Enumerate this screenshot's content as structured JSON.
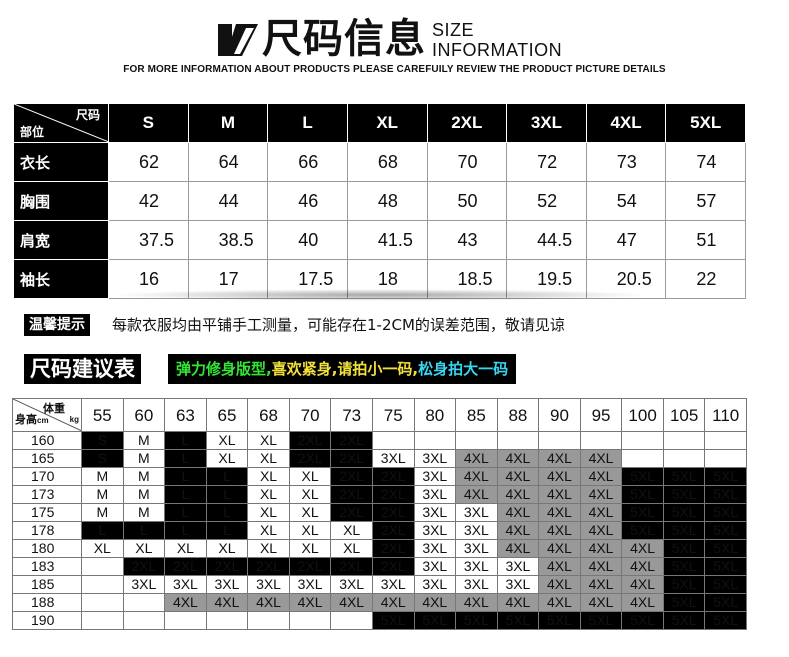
{
  "header": {
    "title_cn": "尺码信息",
    "title_en_line1": "SIZE",
    "title_en_line2": "INFORMATION",
    "subtitle": "FOR MORE INFORMATION ABOUT PRODUCTS PLEASE CAREFUILY REVIEW THE PRODUCT PICTURE DETAILS"
  },
  "size_table": {
    "corner_top": "尺码",
    "corner_bottom": "部位",
    "sizes": [
      "S",
      "M",
      "L",
      "XL",
      "2XL",
      "3XL",
      "4XL",
      "5XL"
    ],
    "rows": [
      {
        "label": "衣长",
        "values": [
          "62",
          "64",
          "66",
          "68",
          "70",
          "72",
          "73",
          "74"
        ]
      },
      {
        "label": "胸围",
        "values": [
          "42",
          "44",
          "46",
          "48",
          "50",
          "52",
          "54",
          "57"
        ]
      },
      {
        "label": "肩宽",
        "values": [
          "37.5",
          "38.5",
          "40",
          "41.5",
          "43",
          "44.5",
          "47",
          "51"
        ]
      },
      {
        "label": "袖长",
        "values": [
          "16",
          "17",
          "17.5",
          "18",
          "18.5",
          "19.5",
          "20.5",
          "22"
        ]
      }
    ]
  },
  "tip": {
    "badge": "温馨提示",
    "text": "每款衣服均由平铺手工测量，可能存在1-2CM的误差范围，敬请见谅"
  },
  "recommend": {
    "title": "尺码建议表",
    "hint_green": "弹力修身版型,",
    "hint_yellow": "喜欢紧身,请拍小一码,",
    "hint_cyan": "松身拍大一码",
    "corner_weight": "体重",
    "corner_kg": "kg",
    "corner_height": "身高",
    "corner_cm": "cm",
    "weights": [
      "55",
      "60",
      "63",
      "65",
      "68",
      "70",
      "73",
      "75",
      "80",
      "85",
      "88",
      "90",
      "95",
      "100",
      "105",
      "110"
    ],
    "rows": [
      {
        "height": "160",
        "cells": [
          "S",
          "M",
          "L",
          "XL",
          "XL",
          "2XL",
          "2XL",
          "",
          "",
          "",
          "",
          "",
          "",
          "",
          "",
          ""
        ]
      },
      {
        "height": "165",
        "cells": [
          "S",
          "M",
          "L",
          "XL",
          "XL",
          "2XL",
          "2XL",
          "3XL",
          "3XL",
          "4XL",
          "4XL",
          "4XL",
          "4XL",
          "",
          "",
          ""
        ]
      },
      {
        "height": "170",
        "cells": [
          "M",
          "M",
          "L",
          "L",
          "XL",
          "XL",
          "2XL",
          "2XL",
          "3XL",
          "4XL",
          "4XL",
          "4XL",
          "4XL",
          "5XL",
          "5XL",
          "5XL"
        ]
      },
      {
        "height": "173",
        "cells": [
          "M",
          "M",
          "L",
          "L",
          "XL",
          "XL",
          "2XL",
          "2XL",
          "3XL",
          "4XL",
          "4XL",
          "4XL",
          "4XL",
          "5XL",
          "5XL",
          "5XL"
        ]
      },
      {
        "height": "175",
        "cells": [
          "M",
          "M",
          "L",
          "L",
          "XL",
          "XL",
          "2XL",
          "2XL",
          "3XL",
          "3XL",
          "4XL",
          "4XL",
          "4XL",
          "5XL",
          "5XL",
          "5XL"
        ]
      },
      {
        "height": "178",
        "cells": [
          "L",
          "L",
          "L",
          "L",
          "XL",
          "XL",
          "XL",
          "2XL",
          "3XL",
          "3XL",
          "4XL",
          "4XL",
          "4XL",
          "5XL",
          "5XL",
          "5XL"
        ]
      },
      {
        "height": "180",
        "cells": [
          "XL",
          "XL",
          "XL",
          "XL",
          "XL",
          "XL",
          "XL",
          "2XL",
          "3XL",
          "3XL",
          "4XL",
          "4XL",
          "4XL",
          "4XL",
          "5XL",
          "5XL"
        ]
      },
      {
        "height": "183",
        "cells": [
          "",
          "2XL",
          "2XL",
          "2XL",
          "2XL",
          "2XL",
          "2XL",
          "2XL",
          "3XL",
          "3XL",
          "3XL",
          "4XL",
          "4XL",
          "4XL",
          "5XL",
          "5XL"
        ]
      },
      {
        "height": "185",
        "cells": [
          "",
          "3XL",
          "3XL",
          "3XL",
          "3XL",
          "3XL",
          "3XL",
          "3XL",
          "3XL",
          "3XL",
          "3XL",
          "4XL",
          "4XL",
          "4XL",
          "5XL",
          "5XL"
        ]
      },
      {
        "height": "188",
        "cells": [
          "",
          "",
          "4XL",
          "4XL",
          "4XL",
          "4XL",
          "4XL",
          "4XL",
          "4XL",
          "4XL",
          "4XL",
          "4XL",
          "4XL",
          "4XL",
          "5XL",
          "5XL"
        ]
      },
      {
        "height": "190",
        "cells": [
          "",
          "",
          "",
          "",
          "",
          "",
          "",
          "5XL",
          "5XL",
          "5XL",
          "5XL",
          "5XL",
          "5XL",
          "5XL",
          "5XL",
          "5XL"
        ]
      }
    ]
  },
  "colors": {
    "black": "#000000",
    "gray_cell": "#999999",
    "hint_green": "#34e534",
    "hint_yellow": "#f2e03a",
    "hint_cyan": "#38d6f0"
  }
}
